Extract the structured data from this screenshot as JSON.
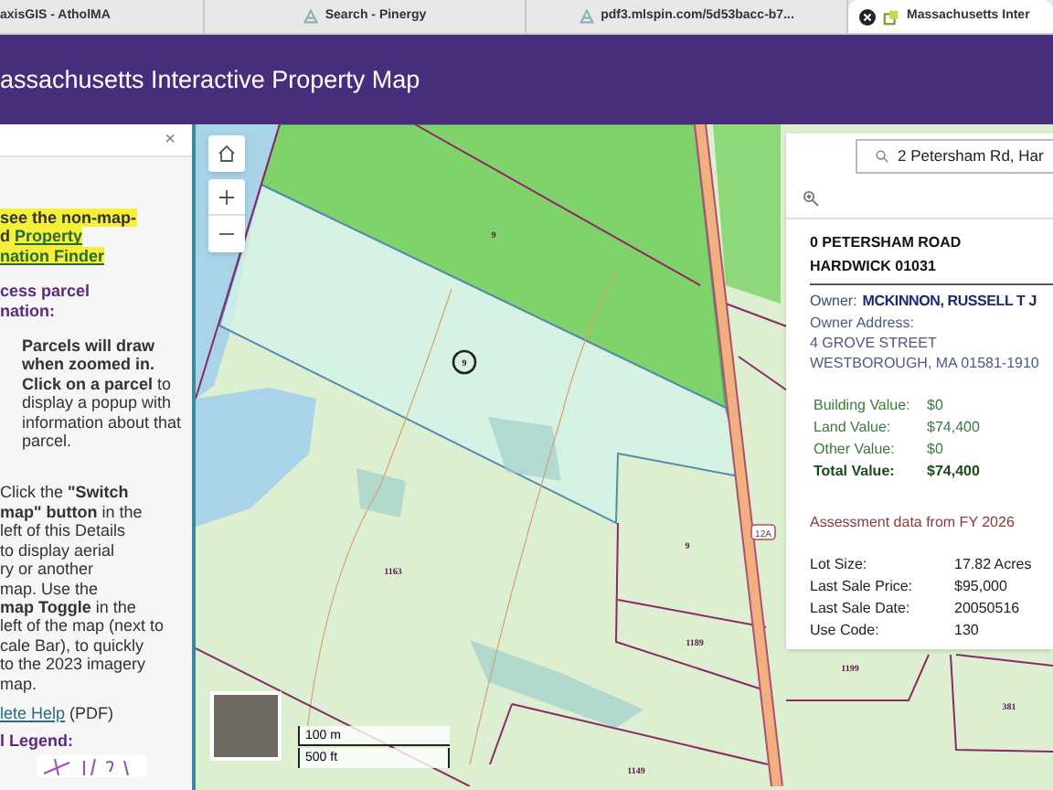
{
  "browser_tabs": [
    {
      "title": "axisGIS - AtholMA",
      "selected": false
    },
    {
      "title": "Search - Pinergy",
      "selected": false
    },
    {
      "title": "pdf3.mlspin.com/5d53bacc-b7...",
      "selected": false
    },
    {
      "title": "Massachusetts Inter",
      "selected": true
    }
  ],
  "header": {
    "title": "assachusetts Interactive Property Map"
  },
  "details_panel": {
    "close": "×",
    "sections": [
      {
        "kind": "note",
        "lines": [
          {
            "text": "see the non-map-"
          },
          {
            "text": "d ",
            "link": "Property"
          },
          {
            "link": "nation Finder"
          }
        ]
      },
      {
        "kind": "heading",
        "lines": [
          {
            "text": "cess parcel"
          },
          {
            "text": "nation:"
          }
        ]
      },
      {
        "kind": "step",
        "lines": [
          {
            "text": "**Parcels will draw**"
          },
          {
            "text": "**when zoomed in.**"
          },
          {
            "text": "**Click on a parcel** to"
          },
          {
            "text": "display a popup with"
          },
          {
            "text": "information about that"
          },
          {
            "text": "parcel."
          }
        ]
      },
      {
        "kind": "step-wide",
        "lines": [
          {
            "text": "Click the **\"Switch**"
          },
          {
            "text": "**map\" button** in the"
          },
          {
            "text": "left of this Details"
          },
          {
            "text": "to display aerial"
          },
          {
            "text": "ry or another"
          },
          {
            "text": "map. Use the"
          },
          {
            "text": "**map Toggle** in the"
          },
          {
            "text": "left of the map (next to"
          },
          {
            "text": "cale Bar), to quickly"
          },
          {
            "text": "to the 2023 imagery"
          },
          {
            "text": "map."
          }
        ]
      },
      {
        "kind": "help",
        "lines": [
          {
            "link": "lete Help",
            "after": " (PDF)"
          }
        ]
      },
      {
        "kind": "heading",
        "lines": [
          {
            "text": "l Legend:"
          }
        ]
      }
    ]
  },
  "map": {
    "parcel_labels": [
      "9",
      "9",
      "1163",
      "9",
      "1189",
      "1149",
      "1199",
      "381"
    ],
    "route_shield": "12A",
    "scale_bar": [
      "100 m",
      "500 ft"
    ]
  },
  "popup": {
    "search": {
      "value": "2 Petersham Rd, Har"
    },
    "address": [
      "0 PETERSHAM ROAD",
      "HARDWICK 01031"
    ],
    "owner_label": "Owner:",
    "owner": "MCKINNON, RUSSELL T J",
    "owner_address_label": "Owner Address:",
    "owner_address": [
      "4 GROVE STREET",
      "WESTBOROUGH, MA 01581-1910"
    ],
    "values": [
      {
        "label": "Building Value:",
        "value": "$0",
        "total": false
      },
      {
        "label": "Land Value:",
        "value": "$74,400",
        "total": false
      },
      {
        "label": "Other Value:",
        "value": "$0",
        "total": false
      },
      {
        "label": "Total Value:",
        "value": "$74,400",
        "total": true
      }
    ],
    "assessment_note": "Assessment data from FY 2026",
    "details": [
      {
        "label": "Lot Size:",
        "value": "17.82 Acres"
      },
      {
        "label": "Last Sale Price:",
        "value": "$95,000"
      },
      {
        "label": "Last Sale Date:",
        "value": "20050516"
      },
      {
        "label": "Use Code:",
        "value": "130"
      }
    ]
  }
}
